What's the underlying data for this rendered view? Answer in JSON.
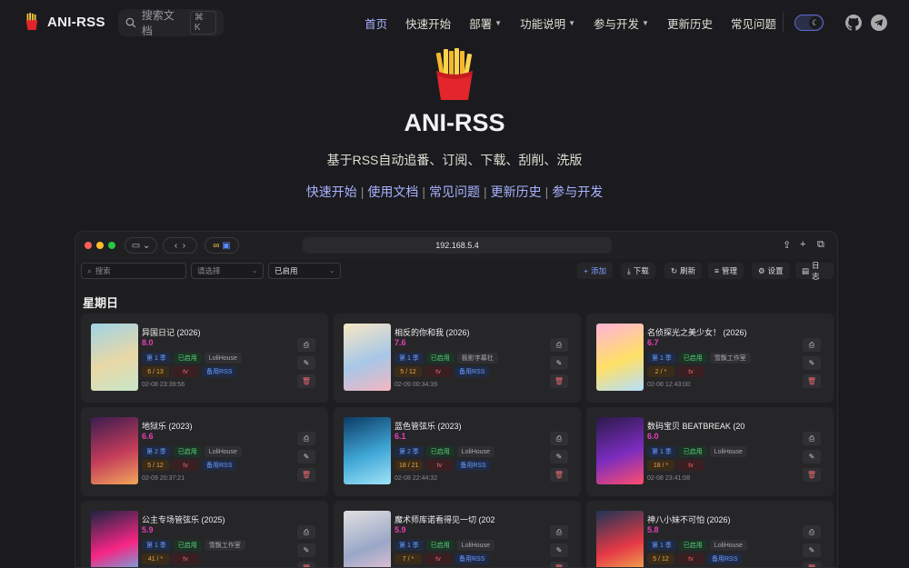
{
  "nav": {
    "brand": "ANI-RSS",
    "search_placeholder": "搜索文档",
    "search_shortcut": "⌘ K",
    "menu": [
      {
        "label": "首页",
        "active": true,
        "dropdown": false
      },
      {
        "label": "快速开始",
        "active": false,
        "dropdown": false
      },
      {
        "label": "部署",
        "active": false,
        "dropdown": true
      },
      {
        "label": "功能说明",
        "active": false,
        "dropdown": true
      },
      {
        "label": "参与开发",
        "active": false,
        "dropdown": true
      },
      {
        "label": "更新历史",
        "active": false,
        "dropdown": false
      },
      {
        "label": "常见问题",
        "active": false,
        "dropdown": false
      }
    ],
    "icons": [
      "moon-icon",
      "github-icon",
      "telegram-icon"
    ]
  },
  "hero": {
    "title": "ANI-RSS",
    "subtitle": "基于RSS自动追番、订阅、下载、刮削、洗版",
    "links": [
      "快速开始",
      "使用文档",
      "常见问题",
      "更新历史",
      "参与开发"
    ]
  },
  "app": {
    "url": "192.168.5.4",
    "search_placeholder": "搜索",
    "select_placeholder": "请选择",
    "filter_value": "已启用",
    "actions": {
      "add": "添加",
      "download": "下载",
      "refresh": "刷新",
      "manage": "管理",
      "settings": "设置",
      "log": "日志"
    },
    "day_label": "星期日",
    "cards": [
      {
        "title": "异国日记 (2026)",
        "score": "8.0",
        "season": "第 1 季",
        "status": "已启用",
        "group": "LoliHouse",
        "progress": "6 / 13",
        "type": "tv",
        "backup": "备用RSS",
        "time": "02-08 23:39:56"
      },
      {
        "title": "相反的你和我 (2026)",
        "score": "7.6",
        "season": "第 1 季",
        "status": "已启用",
        "group": "极影字幕社",
        "progress": "5 / 12",
        "type": "tv",
        "backup": "备用RSS",
        "time": "02-09 00:34:39"
      },
      {
        "title": "名侦探光之美少女！ (2026)",
        "score": "6.7",
        "season": "第 1 季",
        "status": "已启用",
        "group": "雪飘工作室",
        "progress": "2 / *",
        "type": "tv",
        "backup": "",
        "time": "02-08 12:43:00"
      },
      {
        "title": "地狱乐 (2023)",
        "score": "6.6",
        "season": "第 2 季",
        "status": "已启用",
        "group": "LoliHouse",
        "progress": "5 / 12",
        "type": "tv",
        "backup": "备用RSS",
        "time": "02-09 20:37:21"
      },
      {
        "title": "蓝色管弦乐 (2023)",
        "score": "6.1",
        "season": "第 2 季",
        "status": "已启用",
        "group": "LoliHouse",
        "progress": "18 / 21",
        "type": "tv",
        "backup": "备用RSS",
        "time": "02-08 22:44:32"
      },
      {
        "title": "数码宝贝 BEATBREAK (20",
        "score": "6.0",
        "season": "第 1 季",
        "status": "已启用",
        "group": "LoliHouse",
        "progress": "18 / *",
        "type": "tv",
        "backup": "",
        "time": "02-08 23:41:08"
      },
      {
        "title": "公主专场管弦乐 (2025)",
        "score": "5.9",
        "season": "第 1 季",
        "status": "已启用",
        "group": "雪飘工作室",
        "progress": "41 / *",
        "type": "tv",
        "backup": "",
        "time": ""
      },
      {
        "title": "魔术师库诺看得见一切 (202",
        "score": "5.9",
        "season": "第 1 季",
        "status": "已启用",
        "group": "LoliHouse",
        "progress": "7 / *",
        "type": "tv",
        "backup": "备用RSS",
        "time": ""
      },
      {
        "title": "神八小妹不可怕 (2026)",
        "score": "5.8",
        "season": "第 1 季",
        "status": "已启用",
        "group": "LoliHouse",
        "progress": "5 / 12",
        "type": "tv",
        "backup": "备用RSS",
        "time": ""
      }
    ]
  }
}
